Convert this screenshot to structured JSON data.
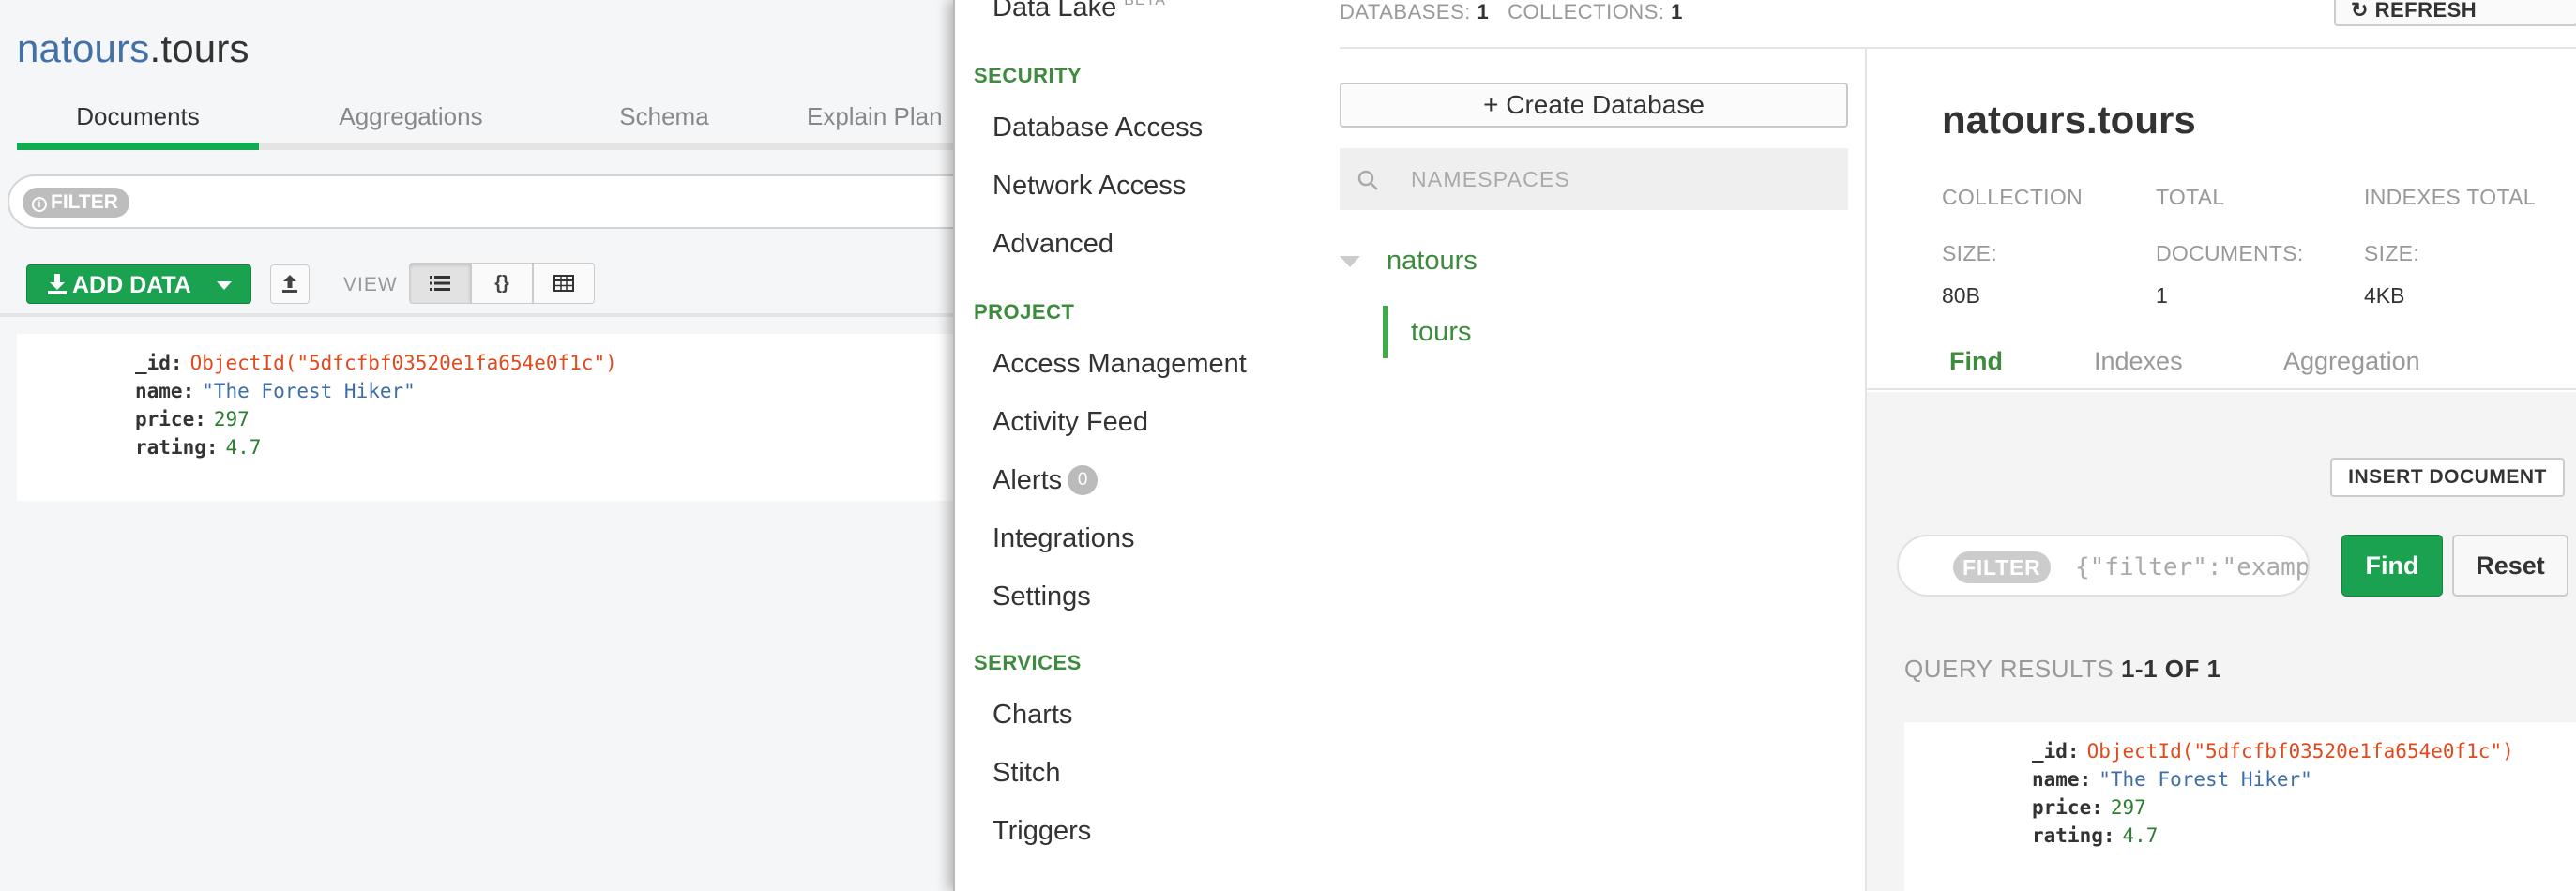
{
  "compass": {
    "namespace_db": "natours",
    "namespace_coll": ".tours",
    "tabs": [
      "Documents",
      "Aggregations",
      "Schema",
      "Explain Plan"
    ],
    "filter_label": "FILTER",
    "add_data_label": "ADD DATA",
    "view_label": "VIEW",
    "view_icons": [
      "list-icon",
      "json-braces-icon",
      "table-icon"
    ],
    "document": {
      "id_key": "_id:",
      "id_value": "ObjectId(\"5dfcfbf03520e1fa654e0f1c\")",
      "name_key": "name:",
      "name_value": "\"The Forest Hiker\"",
      "price_key": "price:",
      "price_value": "297",
      "rating_key": "rating:",
      "rating_value": "4.7"
    }
  },
  "atlas": {
    "sidebar": {
      "data_lake": "Data Lake",
      "data_lake_badge": "BETA",
      "security_head": "SECURITY",
      "security_items": [
        "Database Access",
        "Network Access",
        "Advanced"
      ],
      "project_head": "PROJECT",
      "project_items": [
        "Access Management",
        "Activity Feed",
        "Alerts",
        "Integrations",
        "Settings"
      ],
      "alerts_count": "0",
      "services_head": "SERVICES",
      "services_items": [
        "Charts",
        "Stitch",
        "Triggers"
      ]
    },
    "stats": {
      "databases_label": "DATABASES:",
      "databases_value": "1",
      "collections_label": "COLLECTIONS:",
      "collections_value": "1"
    },
    "create_db_label": "Create Database",
    "namespaces_placeholder": "NAMESPACES",
    "tree": {
      "db": "natours",
      "collection": "tours"
    },
    "refresh_label": "REFRESH",
    "collection": {
      "title": "natours.tours",
      "labels": [
        [
          "COLLECTION",
          "SIZE:"
        ],
        [
          "TOTAL",
          "DOCUMENTS:"
        ],
        [
          "INDEXES TOTAL",
          "SIZE:"
        ]
      ],
      "values": [
        "80B",
        "1",
        "4KB"
      ],
      "tabs": [
        "Find",
        "Indexes",
        "Aggregation"
      ],
      "insert_label": "INSERT DOCUMENT",
      "filter_pill": "FILTER",
      "filter_placeholder": "{\"filter\":\"example\"}",
      "find_label": "Find",
      "reset_label": "Reset",
      "query_label": "QUERY RESULTS",
      "query_range": "1-1 OF 1"
    },
    "colors": {
      "brand_green": "#1aa251",
      "link_green": "#3d8b3d",
      "object_id": "#e04a1c",
      "string": "#3d6ea8"
    }
  }
}
